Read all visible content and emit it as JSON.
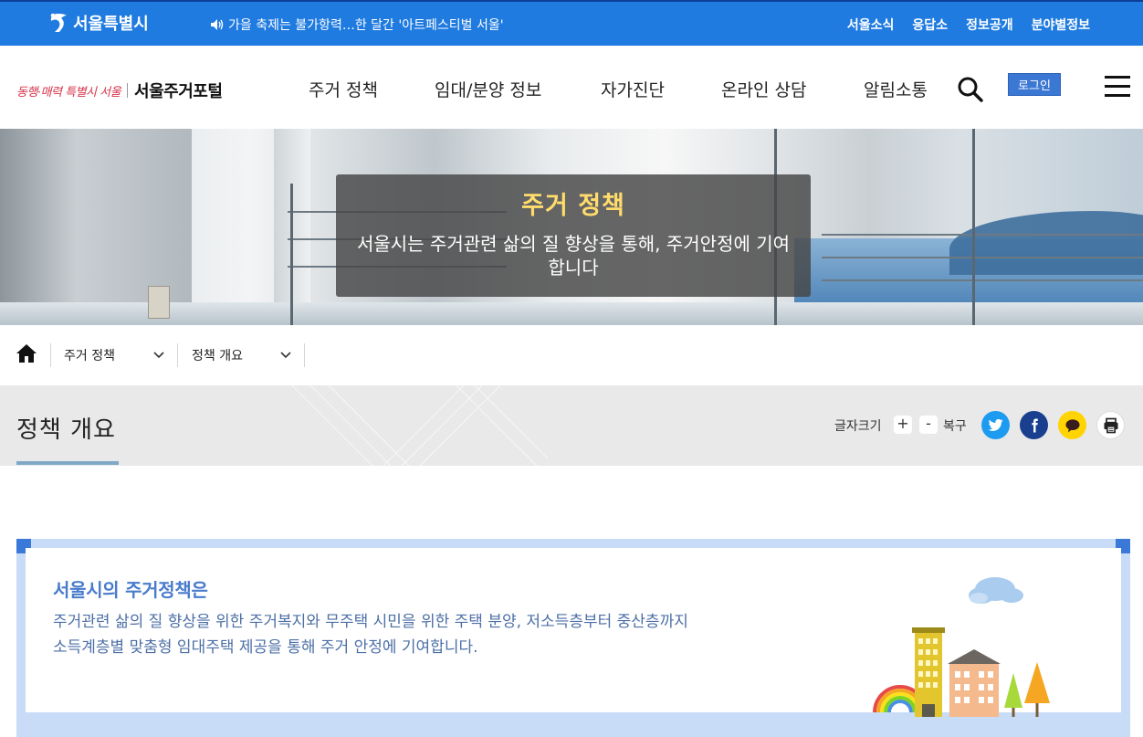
{
  "topbar": {
    "logo_text": "서울특별시",
    "notice": "가을 축제는 불가항력…한 달간 '아트페스티벌 서울'",
    "links": [
      "서울소식",
      "응답소",
      "정보공개",
      "분야별정보"
    ]
  },
  "header": {
    "slogan": "동행·매력 특별시 서울",
    "brand_name": "서울주거포털",
    "nav": [
      "주거 정책",
      "임대/분양 정보",
      "자가진단",
      "온라인 상담",
      "알림소통"
    ],
    "login_label": "로그인"
  },
  "hero": {
    "title": "주거 정책",
    "description": "서울시는 주거관련 삶의 질 향상을 통해, 주거안정에 기여합니다"
  },
  "breadcrumb": {
    "items": [
      "주거 정책",
      "정책 개요"
    ]
  },
  "page": {
    "title": "정책 개요",
    "font_size_label": "글자크기",
    "font_plus": "+",
    "font_minus": "-",
    "reset_label": "복구"
  },
  "share": {
    "icons": [
      "twitter-icon",
      "facebook-icon",
      "kakaotalk-icon",
      "print-icon"
    ]
  },
  "intro": {
    "title": "서울시의 주거정책은",
    "text_line1": "주거관련 삶의 질 향상을 위한 주거복지와 무주택 시민을 위한 주택 분양, 저소득층부터 중산층까지",
    "text_line2": "소득계층별 맞춤형 임대주택 제공을 통해 주거 안정에 기여합니다."
  },
  "colors": {
    "topbar": "#1f7be0",
    "accent": "#3b78d4",
    "hero_title": "#ffdc6b",
    "intro_title": "#4a7ccc",
    "twitter": "#1d9bf0",
    "facebook": "#1a3f8f",
    "kakao": "#ffd400"
  }
}
